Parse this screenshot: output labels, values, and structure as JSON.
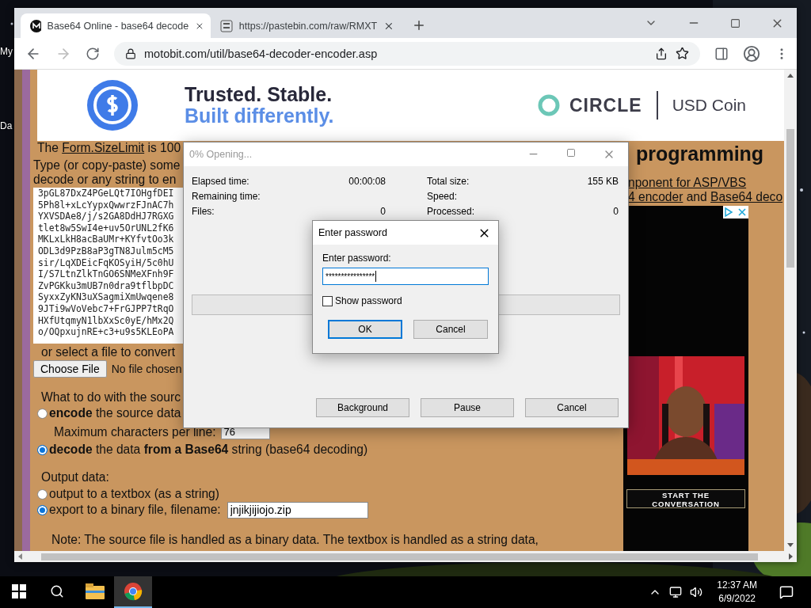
{
  "desktop": {
    "icon_labels": [
      "My",
      "Da"
    ]
  },
  "browser": {
    "tabs": [
      {
        "title": "Base64 Online - base64 decode",
        "selected": true
      },
      {
        "title": "https://pastebin.com/raw/RMXT",
        "selected": false
      }
    ],
    "address": "motobit.com/util/base64-decoder-encoder.asp",
    "forward_disabled": true
  },
  "banner_ad": {
    "headline": "Trusted. Stable.",
    "tagline": "Built differently.",
    "brand": "CIRCLE",
    "product": "USD Coin"
  },
  "page": {
    "size_limit": {
      "prefix": "The ",
      "link": "Form.SizeLimit",
      "suffix": " is 100"
    },
    "instructions": [
      "Type (or copy-paste) some",
      "decode or any string to en"
    ],
    "source_text": [
      "3pGL87DxZ4PGeLQt7IOHgfDEI",
      "5Ph8l+xLcYypxQwwrzFJnAC7h",
      "YXVSDAe8/j/s2GA8DdHJ7RGXG",
      "tlet8w5SwI4e+uv5OrUNL2fK6",
      "MKLxLkH8acBaUMr+KYfvtOo3k",
      "ODL3d9PzB8aP3gTN8Julm5cM5",
      "sir/LqXDEicFqKOSyiH/5c0hU",
      "I/S7LtnZlkTnGO6SNMeXFnh9F",
      "ZvPGKku3mUB7n0dra9tflbpDC",
      "SyxxZyKN3uXSagmiXmUwqene8",
      "9JTi9wVoVebc7+FrGJPP7tRqO",
      "HXfUtqmyN1lbXxSc0yE/hMx2Q",
      "o/OQpxujnRE+c3+u9s5KLEoPA"
    ],
    "file_prompt": "or select a file to convert",
    "file_button": "Choose File",
    "file_status": "No file chosen",
    "action_prompt": "What to do with the sourc",
    "actions": [
      {
        "text": "**encode** the source data",
        "selected": false
      },
      {
        "text": "**decode** the data **from a Base64** string (base64 decoding)",
        "selected": true
      }
    ],
    "max_chars": {
      "label": "Maximum characters per line:",
      "value": "76"
    },
    "output_title": "Output data:",
    "outputs": [
      {
        "label": "output to a textbox (as a string)",
        "selected": false
      },
      {
        "label": "export to a binary file, filename:",
        "selected": true,
        "value": "jnjikjijiojo.zip"
      }
    ],
    "note": "Note: The source file is handled as a binary data. The textbox is handled as a string data,",
    "heading": "programming",
    "link_lines": [
      [
        {
          "text": "nponent for ASP/VBS",
          "link": true
        }
      ],
      [
        {
          "text": "4 encoder",
          "link": true
        },
        {
          "text": " and ",
          "link": false
        },
        {
          "text": "Base64 deco",
          "link": true
        }
      ]
    ]
  },
  "side_ad": {
    "button": "START THE CONVERSATION"
  },
  "progress_dialog": {
    "title": "0% Opening...",
    "stats": [
      {
        "label": "Elapsed time:",
        "value": "00:00:08"
      },
      {
        "label": "Total size:",
        "value": "155 KB"
      },
      {
        "label": "Remaining time:"
      },
      {
        "label": "Speed:"
      },
      {
        "label": "Files:",
        "value": "0"
      },
      {
        "label": "Processed:",
        "value": "0"
      }
    ],
    "level": 0,
    "buttons": [
      "Background",
      "Pause",
      "Cancel"
    ]
  },
  "password_dialog": {
    "title": "Enter password",
    "label": "Enter password:",
    "value": "****************",
    "show_password": {
      "label": "Show password",
      "checked": false
    },
    "buttons": [
      {
        "label": "OK",
        "default": true
      },
      {
        "label": "Cancel",
        "default": false
      }
    ]
  },
  "taskbar": {
    "apps": [
      {
        "kind": "explorer",
        "active": false
      },
      {
        "kind": "chrome",
        "active": true
      }
    ],
    "time": "12:37 AM",
    "date": "6/9/2022"
  }
}
